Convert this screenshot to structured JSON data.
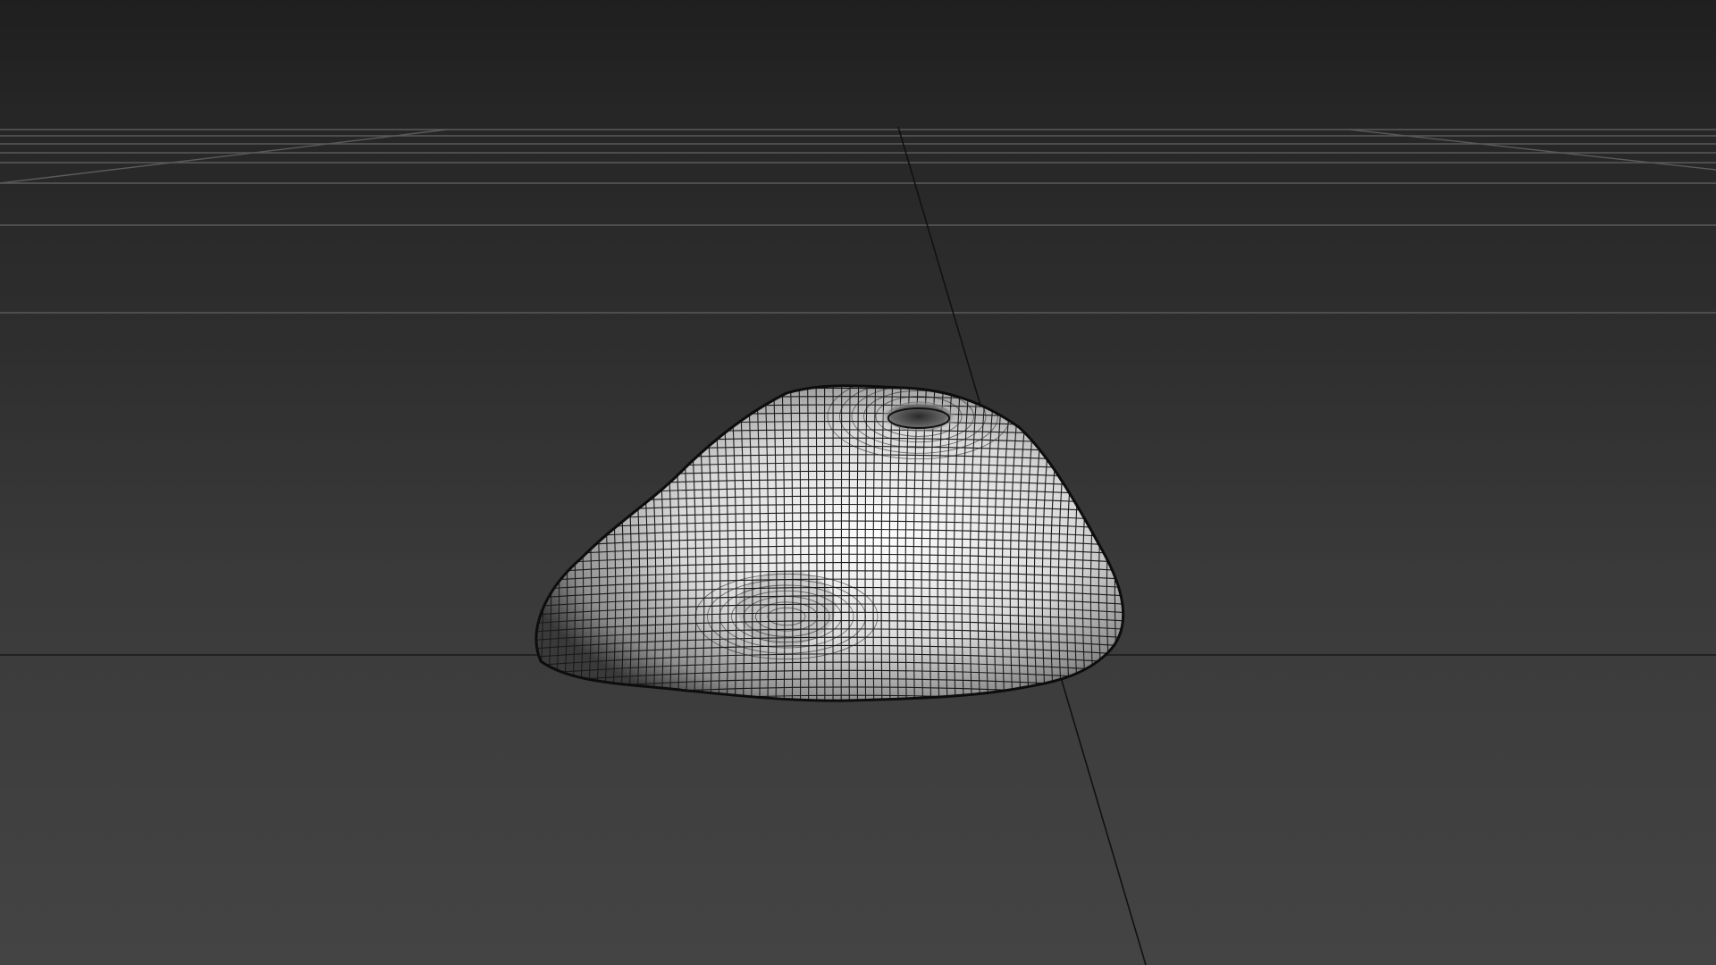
{
  "viewport": {
    "background_top": "#1f1f1f",
    "background_bottom": "#444444",
    "grid_color": "#5a5a5a",
    "axis_color": "#111111"
  },
  "mesh": {
    "name": "wireframe-rock-mesh",
    "surface_color": "#f2f2f2",
    "wire_color": "#1a1a1a"
  }
}
